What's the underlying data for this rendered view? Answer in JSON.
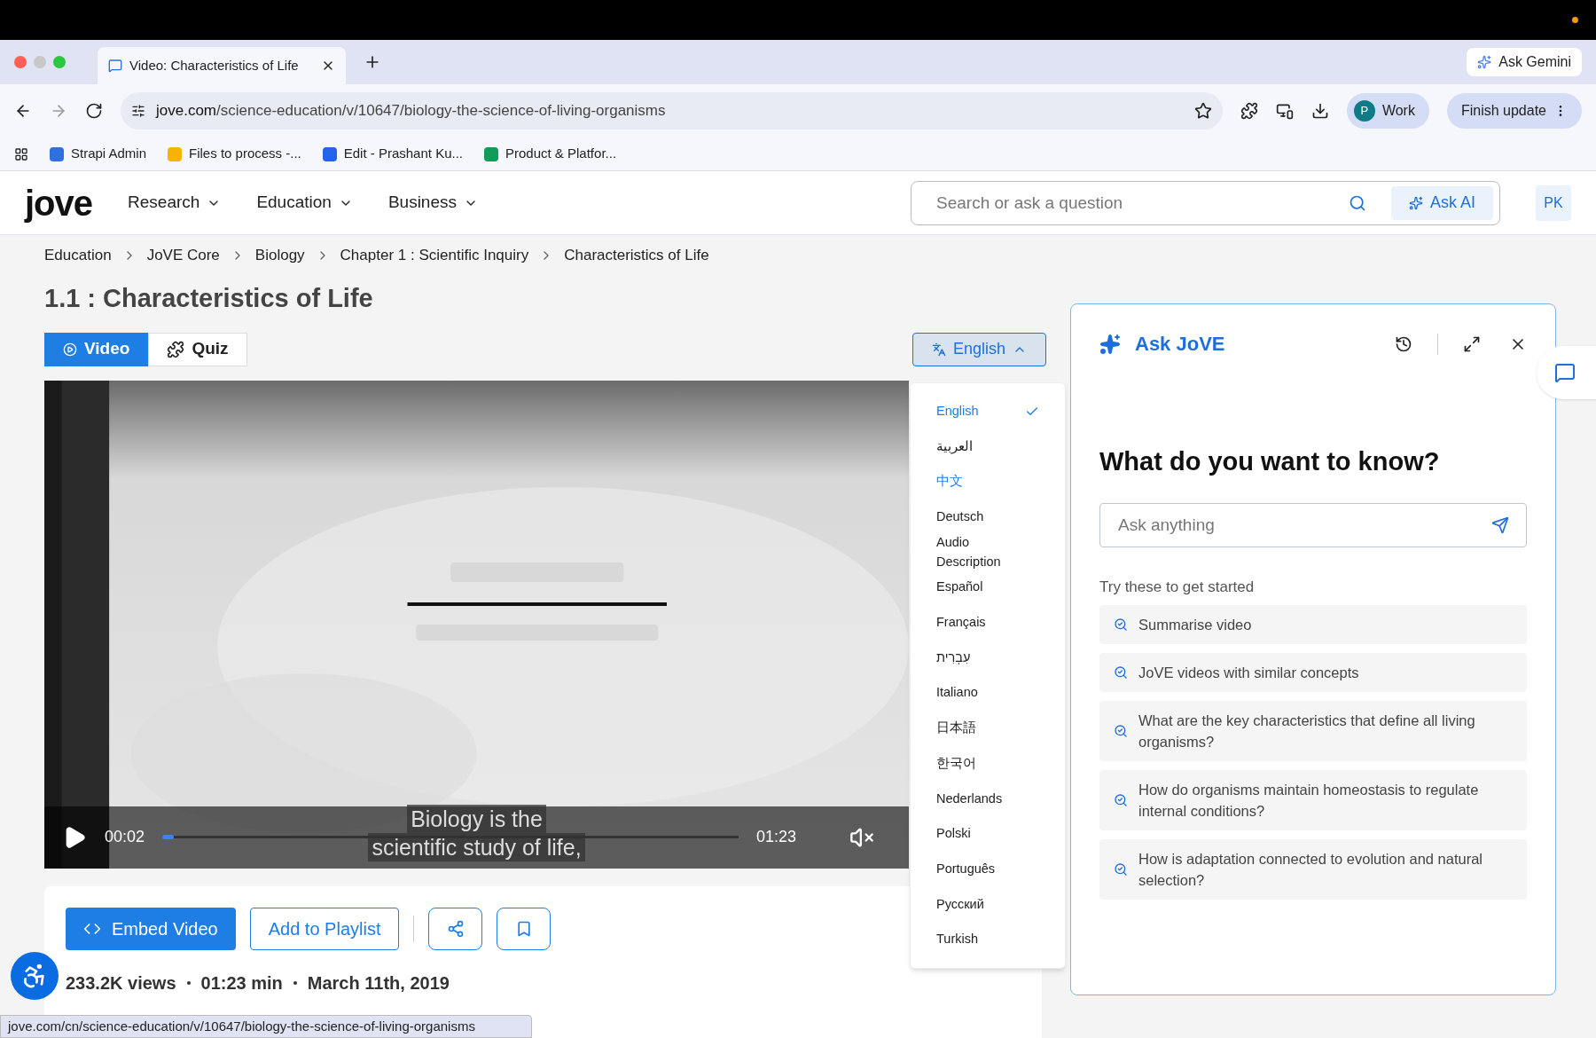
{
  "browser": {
    "tabs": [
      {
        "title": "Video: Characteristics of Life",
        "selected": true
      }
    ],
    "ask_gemini": "Ask Gemini",
    "url_host": "jove.com",
    "url_path": "/science-education/v/10647/biology-the-science-of-living-organisms",
    "profile_initial": "P",
    "profile": "Work",
    "update_button": "Finish update",
    "bookmarks": [
      "Strapi Admin",
      "Files to process -...",
      "Edit - Prashant Ku...",
      "Product & Platfor..."
    ]
  },
  "header": {
    "logo": "jove",
    "nav": [
      "Research",
      "Education",
      "Business"
    ],
    "search": {
      "placeholder": "Search or ask a question"
    },
    "ask_ai": "Ask AI",
    "avatar": "PK"
  },
  "breadcrumbs": [
    "Education",
    "JoVE Core",
    "Biology",
    "Chapter 1 : Scientific Inquiry",
    "Characteristics of Life"
  ],
  "title": "1.1 : Characteristics of Life",
  "content_tabs": [
    {
      "label": "Video",
      "selected": true
    },
    {
      "label": "Quiz",
      "selected": false
    }
  ],
  "language": {
    "label": "English",
    "expanded": true,
    "items": [
      {
        "label": "English",
        "selected": true,
        "hovered": false
      },
      {
        "label": "العربية",
        "selected": false,
        "hovered": false
      },
      {
        "label": "中文",
        "selected": false,
        "hovered": true
      },
      {
        "label": "Deutsch",
        "selected": false,
        "hovered": false
      },
      {
        "label": "Audio Description",
        "selected": false,
        "hovered": false
      },
      {
        "label": "Español",
        "selected": false,
        "hovered": false
      },
      {
        "label": "Français",
        "selected": false,
        "hovered": false
      },
      {
        "label": "עִבְרִית",
        "selected": false,
        "hovered": false
      },
      {
        "label": "Italiano",
        "selected": false,
        "hovered": false
      },
      {
        "label": "日本語",
        "selected": false,
        "hovered": false
      },
      {
        "label": "한국어",
        "selected": false,
        "hovered": false
      },
      {
        "label": "Nederlands",
        "selected": false,
        "hovered": false
      },
      {
        "label": "Polski",
        "selected": false,
        "hovered": false
      },
      {
        "label": "Português",
        "selected": false,
        "hovered": false
      },
      {
        "label": "Русский",
        "selected": false,
        "hovered": false
      },
      {
        "label": "Turkish",
        "selected": false,
        "hovered": false
      }
    ]
  },
  "video": {
    "kind": "picture",
    "time": "00:02",
    "duration": "01:23",
    "level": 0.01,
    "muted": true,
    "captions": [
      "Biology is the",
      "scientific study of life,"
    ]
  },
  "actions": {
    "embed": "Embed Video",
    "playlist": "Add to Playlist"
  },
  "meta": [
    "233.2K views",
    "01:23 min",
    "March 11th, 2019"
  ],
  "ask_panel": {
    "title": "Ask JoVE",
    "heading": "What do you want to know?",
    "input": {
      "placeholder": "Ask anything"
    },
    "prompt_label": "Try these to get started",
    "suggestions": [
      "Summarise video",
      "JoVE videos with similar concepts",
      "What are the key characteristics that define all living organisms?",
      "How do organisms maintain homeostasis to regulate internal conditions?",
      "How is adaptation connected to evolution and natural selection?"
    ]
  },
  "status_url": "jove.com/cn/science-education/v/10647/biology-the-science-of-living-organisms"
}
